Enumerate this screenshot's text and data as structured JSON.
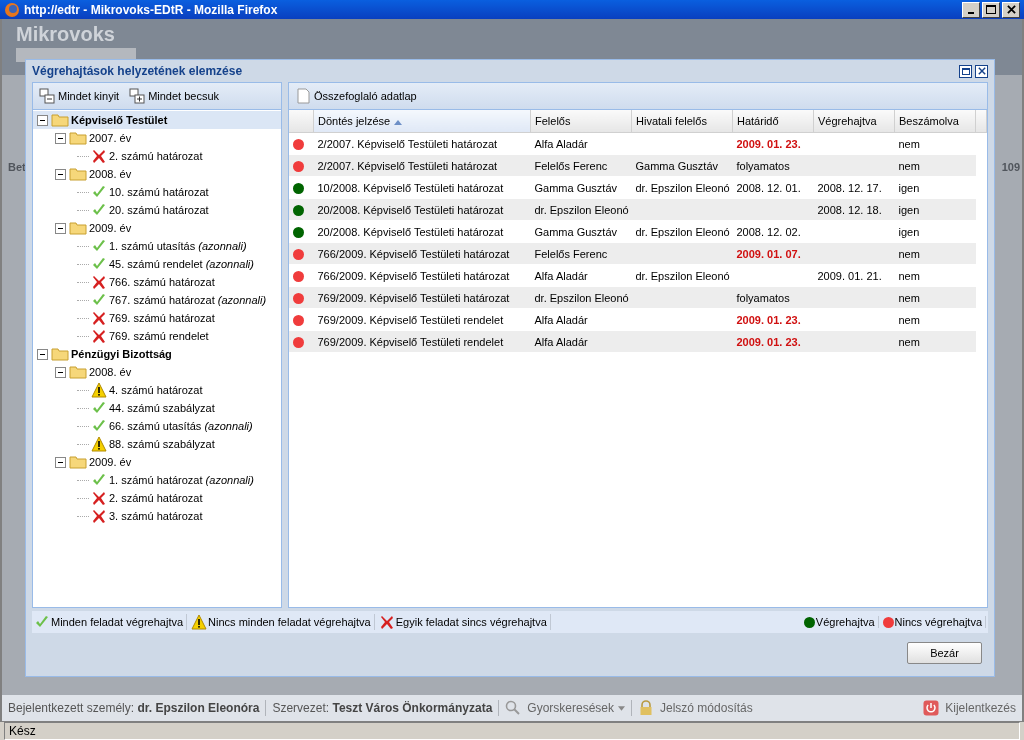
{
  "browser": {
    "title": "http://edtr - Mikrovoks-EDtR - Mozilla Firefox",
    "status": "Kész"
  },
  "background": {
    "logo": "Mikrovoks",
    "left_fragment": "Bet",
    "right_fragment": "109"
  },
  "dialog": {
    "title": "Végrehajtások helyzetének elemzése",
    "tree_toolbar": [
      {
        "label": "Mindet kinyit",
        "kind": "expand"
      },
      {
        "label": "Mindet becsuk",
        "kind": "collapse"
      }
    ],
    "tree": [
      {
        "label": "Képviselő Testület",
        "expanded": true,
        "selected": true,
        "children": [
          {
            "label": "2007. év",
            "expanded": true,
            "selected": false,
            "children": [
              {
                "label": "2. számú határozat",
                "kind": "failed",
                "selected": false
              }
            ]
          },
          {
            "label": "2008. év",
            "expanded": true,
            "selected": false,
            "children": [
              {
                "label": "10. számú határozat",
                "kind": "done",
                "selected": false
              },
              {
                "label": "20. számú határozat",
                "kind": "done",
                "selected": false
              }
            ]
          },
          {
            "label": "2009. év",
            "expanded": true,
            "selected": false,
            "children": [
              {
                "label": "1. számú utasítás *(azonnali)*",
                "kind": "done",
                "selected": false
              },
              {
                "label": "45. számú rendelet *(azonnali)*",
                "kind": "done",
                "selected": false
              },
              {
                "label": "766. számú határozat",
                "kind": "failed",
                "selected": false
              },
              {
                "label": "767. számú határozat *(azonnali)*",
                "kind": "done",
                "selected": false
              },
              {
                "label": "769. számú határozat",
                "kind": "failed",
                "selected": false
              },
              {
                "label": "769. számú rendelet",
                "kind": "failed",
                "selected": false
              }
            ]
          }
        ]
      },
      {
        "label": "Pénzügyi Bizottság",
        "expanded": true,
        "selected": false,
        "children": [
          {
            "label": "2008. év",
            "expanded": true,
            "selected": false,
            "children": [
              {
                "label": "4. számú határozat",
                "kind": "partial",
                "selected": false
              },
              {
                "label": "44. számú szabályzat",
                "kind": "done",
                "selected": false
              },
              {
                "label": "66. számú utasítás *(azonnali)*",
                "kind": "done",
                "selected": false
              },
              {
                "label": "88. számú szabályzat",
                "kind": "partial",
                "selected": false
              }
            ]
          },
          {
            "label": "2009. év",
            "expanded": true,
            "selected": false,
            "children": [
              {
                "label": "1. számú határozat *(azonnali)*",
                "kind": "done",
                "selected": false
              },
              {
                "label": "2. számú határozat",
                "kind": "failed",
                "selected": false
              },
              {
                "label": "3. számú határozat",
                "kind": "failed",
                "selected": false
              }
            ]
          }
        ]
      }
    ],
    "grid_toolbar": {
      "label": "Összefoglaló adatlap"
    },
    "columns": [
      {
        "label": "Döntés jelzése",
        "sorted": true
      },
      {
        "label": "Felelős",
        "sorted": false
      },
      {
        "label": "Hivatali felelős",
        "sorted": false
      },
      {
        "label": "Határidő",
        "sorted": false
      },
      {
        "label": "Végrehajtva",
        "sorted": false
      },
      {
        "label": "Beszámolva",
        "sorted": false
      }
    ],
    "rows": [
      {
        "color": "#f03c3c",
        "decision": "2/2007. Képviselő Testületi határozat",
        "responsible": "Alfa Aladár",
        "deadline": "2009. 01. 23.",
        "overdue": true,
        "reported": "nem"
      },
      {
        "color": "#f03c3c",
        "decision": "2/2007. Képviselő Testületi határozat",
        "responsible": "Felelős Ferenc",
        "office": "Gamma Gusztáv",
        "deadline": "folyamatos",
        "overdue": false,
        "reported": "nem"
      },
      {
        "color": "#006400",
        "decision": "10/2008. Képviselő Testületi határozat",
        "responsible": "Gamma Gusztáv",
        "office": "dr. Epszilon Eleonó",
        "deadline": "2008. 12. 01.",
        "overdue": false,
        "executed": "2008. 12. 17.",
        "reported": "igen"
      },
      {
        "color": "#006400",
        "decision": "20/2008. Képviselő Testületi határozat",
        "responsible": "dr. Epszilon Eleonó",
        "executed": "2008. 12. 18.",
        "reported": "igen"
      },
      {
        "color": "#006400",
        "decision": "20/2008. Képviselő Testületi határozat",
        "responsible": "Gamma Gusztáv",
        "office": "dr. Epszilon Eleonó",
        "deadline": "2008. 12. 02.",
        "overdue": false,
        "reported": "igen"
      },
      {
        "color": "#f03c3c",
        "decision": "766/2009. Képviselő Testületi határozat",
        "responsible": "Felelős Ferenc",
        "deadline": "2009. 01. 07.",
        "overdue": true,
        "reported": "nem"
      },
      {
        "color": "#f03c3c",
        "decision": "766/2009. Képviselő Testületi határozat",
        "responsible": "Alfa Aladár",
        "office": "dr. Epszilon Eleonó",
        "executed": "2009. 01. 21.",
        "reported": "nem"
      },
      {
        "color": "#f03c3c",
        "decision": "769/2009. Képviselő Testületi határozat",
        "responsible": "dr. Epszilon Eleonó",
        "deadline": "folyamatos",
        "overdue": false,
        "reported": "nem"
      },
      {
        "color": "#f03c3c",
        "decision": "769/2009. Képviselő Testületi rendelet",
        "responsible": "Alfa Aladár",
        "deadline": "2009. 01. 23.",
        "overdue": true,
        "reported": "nem"
      },
      {
        "color": "#f03c3c",
        "decision": "769/2009. Képviselő Testületi rendelet",
        "responsible": "Alfa Aladár",
        "deadline": "2009. 01. 23.",
        "overdue": true,
        "reported": "nem"
      }
    ],
    "legend_left": [
      {
        "kind": "done",
        "label": "Minden feladat végrehajtva"
      },
      {
        "kind": "partial",
        "label": "Nincs minden feladat végrehajtva"
      },
      {
        "kind": "failed",
        "label": "Egyik feladat sincs végrehajtva"
      }
    ],
    "legend_right": [
      {
        "color": "#006400",
        "label": "Végrehajtva"
      },
      {
        "color": "#f03c3c",
        "label": "Nincs végrehajtva"
      }
    ],
    "close_button": "Bezár"
  },
  "app_bar": {
    "user_label": "Bejelentkezett személy:",
    "user": "dr. Epszilon Eleonóra",
    "org_label": "Szervezet:",
    "org": "Teszt Város Önkormányzata",
    "quick_search": "Gyorskeresések",
    "password": "Jelszó módosítás",
    "logout": "Kijelentkezés"
  }
}
